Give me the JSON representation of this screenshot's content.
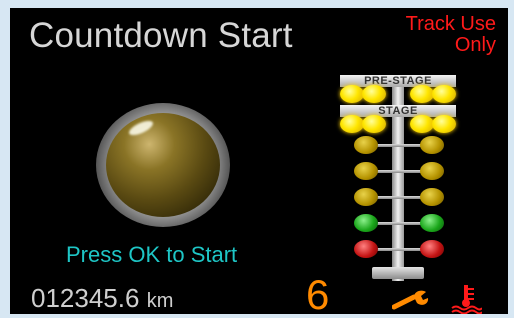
{
  "header": {
    "title": "Countdown Start",
    "notice_line1": "Track Use",
    "notice_line2": "Only"
  },
  "tree": {
    "prestage_label": "PRE-STAGE",
    "stage_label": "STAGE",
    "lights": [
      "yellow-on",
      "yellow-on",
      "amber",
      "amber",
      "amber",
      "green",
      "red"
    ]
  },
  "main": {
    "instruction": "Press OK to Start"
  },
  "status": {
    "odometer": "012345.6",
    "odometer_unit": "km",
    "gear": "6",
    "icons": [
      "wrench-icon",
      "coolant-temperature-icon"
    ]
  },
  "colors": {
    "title": "#d6d6d6",
    "notice": "#ff1a1a",
    "instruction": "#1ec6c6",
    "gear": "#ff8a00",
    "background": "#000000",
    "border": "#d7e7f3"
  }
}
